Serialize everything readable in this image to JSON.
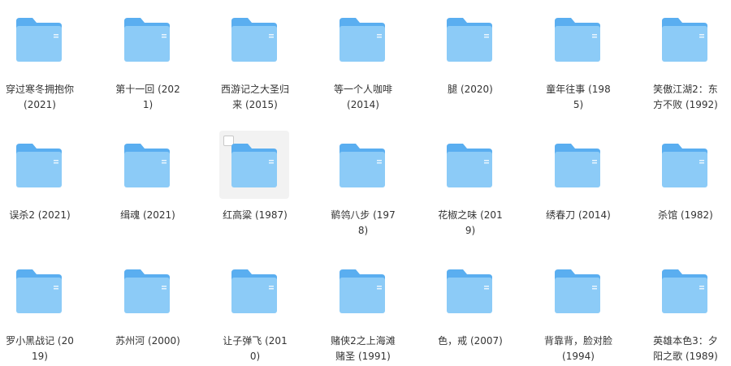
{
  "accent_color": "#5aaef0",
  "folders": [
    {
      "name": "穿过寒冬拥抱你 (2021)"
    },
    {
      "name": "第十一回 (2021)"
    },
    {
      "name": "西游记之大圣归来 (2015)"
    },
    {
      "name": "等一个人咖啡 (2014)"
    },
    {
      "name": "腿 (2020)"
    },
    {
      "name": "童年往事 (1985)"
    },
    {
      "name": "笑傲江湖2：东方不败 (1992)"
    },
    {
      "name": "误杀2 (2021)"
    },
    {
      "name": "缉魂 (2021)"
    },
    {
      "name": "红高粱 (1987)"
    },
    {
      "name": "鹡鸰八步 (1978)"
    },
    {
      "name": "花椒之味 (2019)"
    },
    {
      "name": "绣春刀 (2014)"
    },
    {
      "name": "杀馆 (1982)"
    },
    {
      "name": "罗小黑战记 (2019)"
    },
    {
      "name": "苏州河 (2000)"
    },
    {
      "name": "让子弹飞 (2010)"
    },
    {
      "name": "赌侠2之上海滩赌圣 (1991)"
    },
    {
      "name": "色，戒 (2007)"
    },
    {
      "name": "背靠背，脸对脸 (1994)"
    },
    {
      "name": "英雄本色3：夕阳之歌 (1989)"
    }
  ]
}
